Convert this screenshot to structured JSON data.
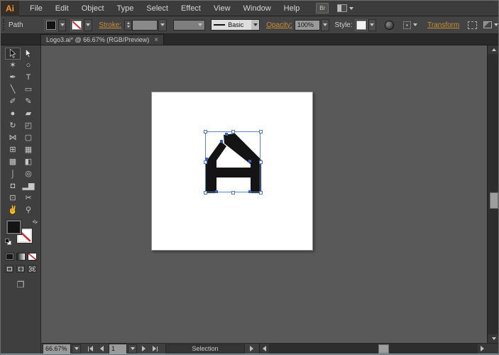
{
  "menubar": {
    "logo": "Ai",
    "items": [
      "File",
      "Edit",
      "Object",
      "Type",
      "Select",
      "Effect",
      "View",
      "Window",
      "Help"
    ],
    "bridge_label": "Br"
  },
  "control_bar": {
    "context_label": "Path",
    "fill_color": "#141414",
    "stroke_swatch": "none",
    "stroke_label": "Stroke:",
    "brush_name": "Basic",
    "opacity_label": "Opacity:",
    "opacity_value": "100%",
    "style_label": "Style:",
    "transform_label": "Transform"
  },
  "tab": {
    "title": "Logo3.ai* @ 66.67% (RGB/Preview)",
    "close": "×"
  },
  "toolbar": {
    "tools": [
      {
        "name": "selection",
        "glyph": "",
        "selected": true
      },
      {
        "name": "direct-selection",
        "glyph": ""
      },
      {
        "name": "magic-wand",
        "glyph": "✶"
      },
      {
        "name": "lasso",
        "glyph": "○"
      },
      {
        "name": "pen",
        "glyph": "✒"
      },
      {
        "name": "type",
        "glyph": "T"
      },
      {
        "name": "line-segment",
        "glyph": "╲"
      },
      {
        "name": "rectangle",
        "glyph": "▭"
      },
      {
        "name": "paintbrush",
        "glyph": "✐"
      },
      {
        "name": "pencil",
        "glyph": "✎"
      },
      {
        "name": "blob-brush",
        "glyph": "●"
      },
      {
        "name": "eraser",
        "glyph": "▰"
      },
      {
        "name": "rotate",
        "glyph": "↻"
      },
      {
        "name": "scale",
        "glyph": "◰"
      },
      {
        "name": "width",
        "glyph": "⋈"
      },
      {
        "name": "free-transform",
        "glyph": "▢"
      },
      {
        "name": "shape-builder",
        "glyph": "⊞"
      },
      {
        "name": "perspective-grid",
        "glyph": "▦"
      },
      {
        "name": "mesh",
        "glyph": "▩"
      },
      {
        "name": "gradient",
        "glyph": "◧"
      },
      {
        "name": "eyedropper",
        "glyph": "⌡"
      },
      {
        "name": "blend",
        "glyph": "◎"
      },
      {
        "name": "symbol-sprayer",
        "glyph": "◘"
      },
      {
        "name": "column-graph",
        "glyph": "▂▆"
      },
      {
        "name": "artboard",
        "glyph": "⊡"
      },
      {
        "name": "slice",
        "glyph": "✂"
      },
      {
        "name": "hand",
        "glyph": "✌"
      },
      {
        "name": "zoom",
        "glyph": "⚲"
      }
    ],
    "swap_icon_glyph": "⇄",
    "screen_mode_glyph": "❐"
  },
  "statusbar": {
    "zoom_value": "66.67%",
    "artboard_value": "1",
    "status_text": "Selection"
  },
  "canvas": {
    "artboard_fill": "#ffffff",
    "logo_fill": "#141414",
    "selection_color": "#5b85cf"
  },
  "icons": {
    "dropdown-arrow": "css-triangle-down",
    "workspace-switcher-icon": "layout-columns",
    "recolor-artwork-icon": "dark-circle",
    "select-similar-icon": "dotted-square",
    "isolate-selected-object-icon": "dashed-box"
  },
  "colors": {
    "accent_link": "#cc9033",
    "ui_dark": "#3f3f3f",
    "canvas_gray": "#595959",
    "logo_orange": "#f7941d",
    "selection_blue": "#5b85cf"
  }
}
